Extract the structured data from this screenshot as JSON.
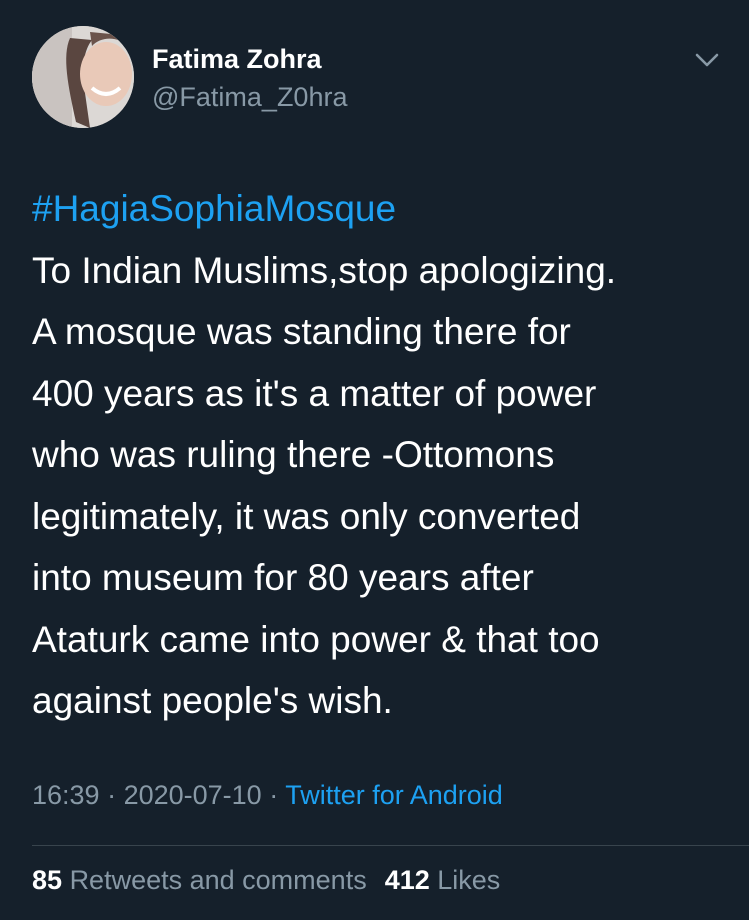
{
  "tweet": {
    "author": {
      "name": "Fatima Zohra",
      "handle": "@Fatima_Z0hra"
    },
    "hashtag": "#HagiaSophiaMosque",
    "lines": [
      "To Indian Muslims,stop apologizing.",
      "A mosque was standing there for",
      "400 years as it's a matter of power",
      "who was ruling there -Ottomons",
      "legitimately, it was only converted",
      "into museum for 80 years after",
      "Ataturk came into power & that too",
      "against people's wish."
    ],
    "time": "16:39",
    "date": "2020-07-10",
    "separator": " · ",
    "source": "Twitter for Android",
    "stats": {
      "retweets_count": "85",
      "retweets_label": "Retweets and comments",
      "likes_count": "412",
      "likes_label": "Likes"
    }
  },
  "icons": {
    "menu": "chevron-down-icon"
  },
  "colors": {
    "background": "#15202b",
    "text": "#ffffff",
    "secondary_text": "#8899a6",
    "accent": "#1da1f2",
    "divider": "#38444d"
  }
}
